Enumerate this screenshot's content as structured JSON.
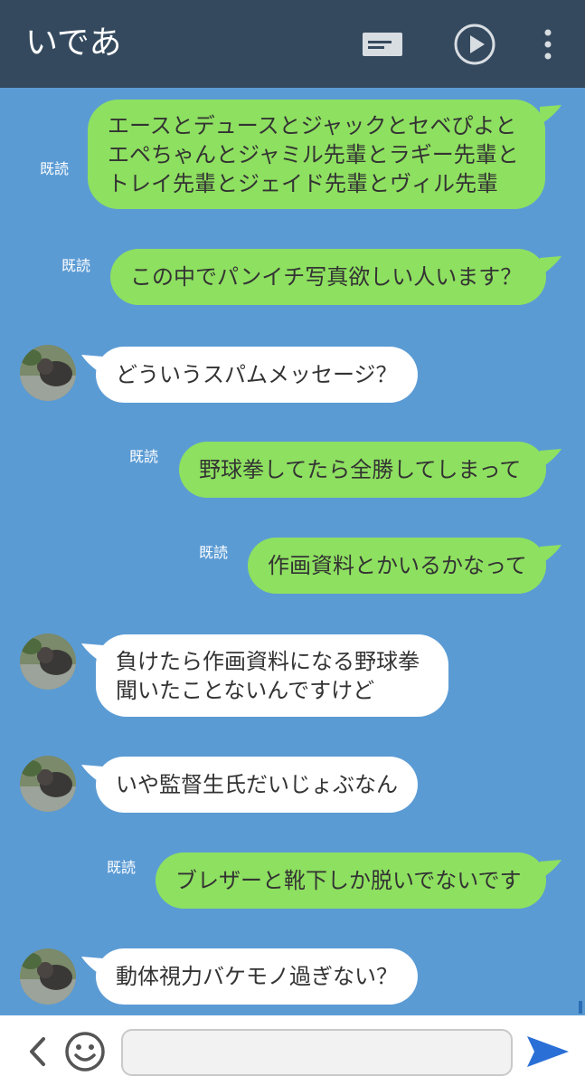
{
  "header": {
    "title": "いであ"
  },
  "messages": [
    {
      "side": "out",
      "read": "既読",
      "lines": [
        "エースとデュースとジャックとセベぴよと",
        "エペちゃんとジャミル先輩とラギー先輩と",
        "トレイ先輩とジェイド先輩とヴィル先輩"
      ]
    },
    {
      "side": "out",
      "read": "既読",
      "lines": [
        "この中でパンイチ写真欲しい人います？"
      ]
    },
    {
      "side": "in",
      "lines": [
        "どういうスパムメッセージ？"
      ]
    },
    {
      "side": "out",
      "read": "既読",
      "lines": [
        "野球拳してたら全勝してしまって"
      ]
    },
    {
      "side": "out",
      "read": "既読",
      "lines": [
        "作画資料とかいるかなって"
      ]
    },
    {
      "side": "in",
      "lines": [
        "負けたら作画資料になる野球拳",
        "聞いたことないんですけど"
      ]
    },
    {
      "side": "in",
      "lines": [
        "いや監督生氏だいじょぶなん"
      ]
    },
    {
      "side": "out",
      "read": "既読",
      "lines": [
        "ブレザーと靴下しか脱いでないです"
      ]
    },
    {
      "side": "in",
      "lines": [
        "動体視力バケモノ過ぎない？"
      ]
    }
  ],
  "footer": {
    "input_value": "",
    "input_placeholder": ""
  },
  "colors": {
    "header_bg": "#34495e",
    "chat_bg": "#5b9bd4",
    "outgoing_bubble": "#8ee060",
    "incoming_bubble": "#ffffff",
    "send_icon": "#2a6fd6"
  },
  "icons": {
    "header": [
      "note-icon",
      "play-icon",
      "more-vert-icon"
    ],
    "footer": [
      "back-chevron-icon",
      "emoji-icon",
      "send-icon"
    ]
  }
}
